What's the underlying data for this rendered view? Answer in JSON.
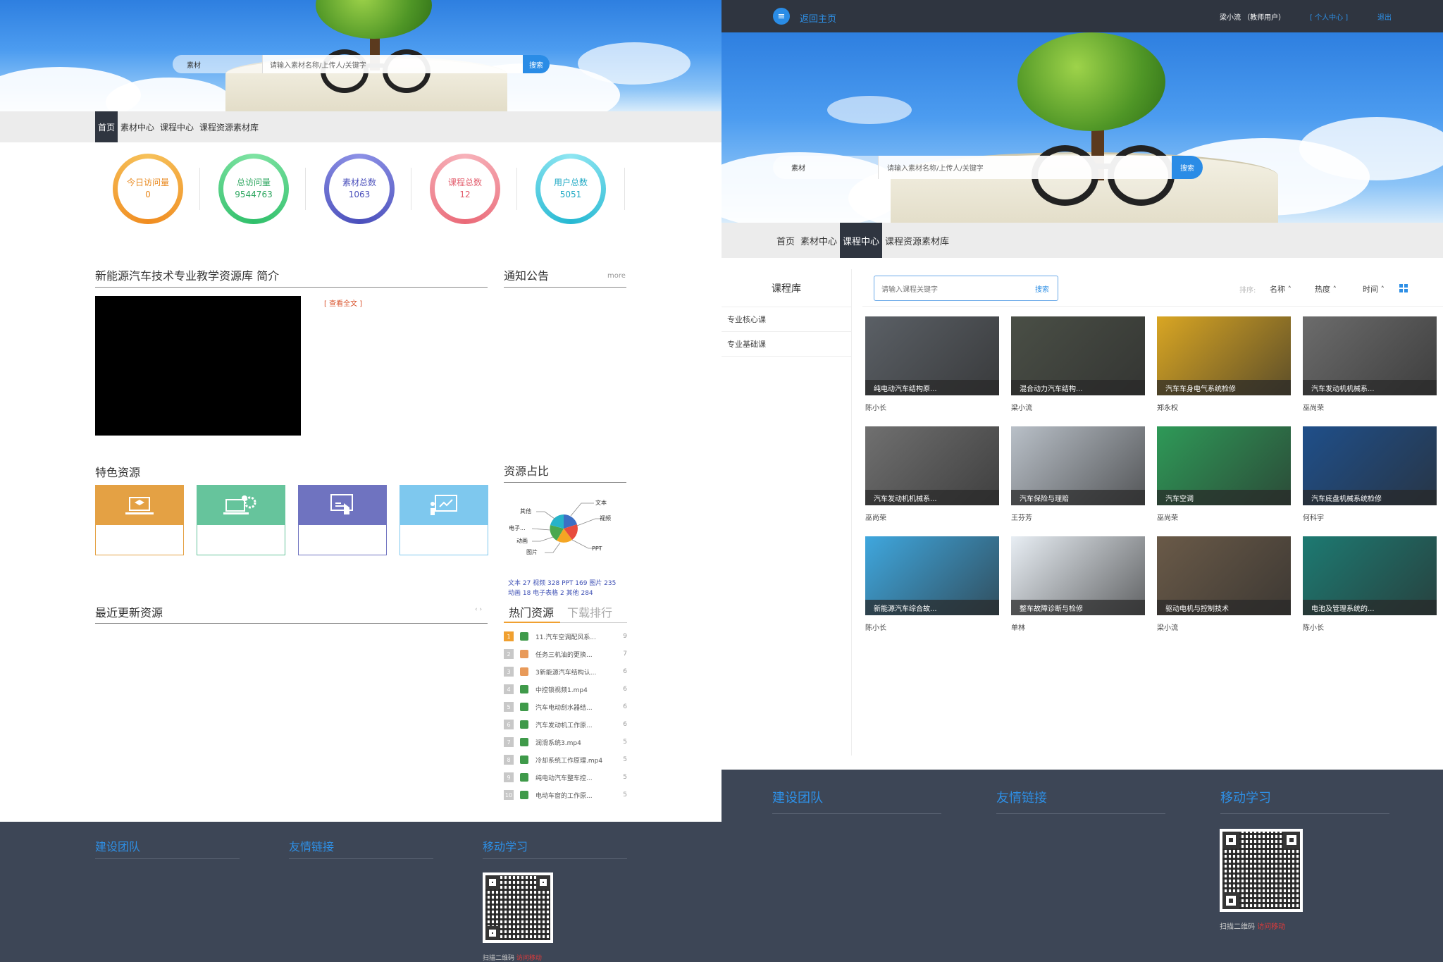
{
  "left": {
    "search": {
      "select": "素材",
      "placeholder": "请输入素材名称/上传人/关键字",
      "button": "搜索"
    },
    "nav": [
      "首页",
      "素材中心",
      "课程中心",
      "课程资源素材库"
    ],
    "nav_active": "首页",
    "stats": [
      {
        "label": "今日访问量",
        "value": "0",
        "color": "#f0a030"
      },
      {
        "label": "总访问量",
        "value": "9544763",
        "color": "#3cc77a"
      },
      {
        "label": "素材总数",
        "value": "1063",
        "color": "#5a5fc8"
      },
      {
        "label": "课程总数",
        "value": "12",
        "color": "#f07a86"
      },
      {
        "label": "用户总数",
        "value": "5051",
        "color": "#33c3d8"
      }
    ],
    "intro_title": "新能源汽车技术专业教学资源库 简介",
    "read_more": "[ 查看全文 ]",
    "notice_title": "通知公告",
    "notice_more": "more",
    "featured_title": "特色资源",
    "featured_colors": [
      "#e4a144",
      "#66c49c",
      "#6f73c0",
      "#7ec8ee"
    ],
    "ratio_title": "资源占比",
    "pie_labels": [
      "文本",
      "视频",
      "PPT",
      "其他",
      "电子...",
      "动画",
      "图片"
    ],
    "ratio_line1": "文本 27 视频 328 PPT 169 图片 235",
    "ratio_line2": "动画 18 电子表格 2 其他 284",
    "recent_title": "最近更新资源",
    "tabs": [
      "热门资源",
      "下载排行"
    ],
    "hot": [
      {
        "rank": "1",
        "name": "11.汽车空调配风系...",
        "count": "9"
      },
      {
        "rank": "2",
        "name": "任务三机油的更换...",
        "count": "7"
      },
      {
        "rank": "3",
        "name": "3新能源汽车结构认...",
        "count": "6"
      },
      {
        "rank": "4",
        "name": "中控锁视频1.mp4",
        "count": "6"
      },
      {
        "rank": "5",
        "name": "汽车电动刮水器结...",
        "count": "6"
      },
      {
        "rank": "6",
        "name": "汽车发动机工作原...",
        "count": "6"
      },
      {
        "rank": "7",
        "name": "润滑系统3.mp4",
        "count": "5"
      },
      {
        "rank": "8",
        "name": "冷却系统工作原理.mp4",
        "count": "5"
      },
      {
        "rank": "9",
        "name": "纯电动汽车整车控...",
        "count": "5"
      },
      {
        "rank": "10",
        "name": "电动车窗的工作原...",
        "count": "5"
      }
    ],
    "footer": {
      "team": "建设团队",
      "links": "友情链接",
      "mobile": "移动学习",
      "scan": "扫描二维码",
      "scan_link": "访问移动"
    }
  },
  "right": {
    "back_home": "返回主页",
    "user": "梁小流 （教师用户）",
    "personal": "[ 个人中心 ]",
    "logout": "退出",
    "search": {
      "select": "素材",
      "placeholder": "请输入素材名称/上传人/关键字",
      "button": "搜索"
    },
    "nav": [
      "首页",
      "素材中心",
      "课程中心",
      "课程资源素材库"
    ],
    "nav_active": "课程中心",
    "library_title": "课程库",
    "categories": [
      "专业核心课",
      "专业基础课"
    ],
    "course_search_placeholder": "请输入课程关键字",
    "course_search_btn": "搜索",
    "sort_label": "排序:",
    "sort": [
      "名称",
      "热度",
      "时间"
    ],
    "courses": [
      {
        "title": "纯电动汽车结构原...",
        "author": "陈小长",
        "bg": "#5b6066"
      },
      {
        "title": "混合动力汽车结构...",
        "author": "梁小流",
        "bg": "#4a4f46"
      },
      {
        "title": "汽车车身电气系统检修",
        "author": "郑永权",
        "bg": "#d9a623"
      },
      {
        "title": "汽车发动机机械系...",
        "author": "巫尚荣",
        "bg": "#6c6c6c"
      },
      {
        "title": "汽车发动机机械系...",
        "author": "巫尚荣",
        "bg": "#707070"
      },
      {
        "title": "汽车保险与理赔",
        "author": "王芬芳",
        "bg": "#b9c0c8"
      },
      {
        "title": "汽车空调",
        "author": "巫尚荣",
        "bg": "#2e9a58"
      },
      {
        "title": "汽车底盘机械系统检修",
        "author": "何科宇",
        "bg": "#1f4f8a"
      },
      {
        "title": "新能源汽车综合故...",
        "author": "陈小长",
        "bg": "#3fa7de"
      },
      {
        "title": "整车故障诊断与检修",
        "author": "单林",
        "bg": "#e8eef4"
      },
      {
        "title": "驱动电机与控制技术",
        "author": "梁小流",
        "bg": "#6a5a48"
      },
      {
        "title": "电池及管理系统的...",
        "author": "陈小长",
        "bg": "#1d7a72"
      }
    ],
    "footer": {
      "team": "建设团队",
      "links": "友情链接",
      "mobile": "移动学习",
      "scan": "扫描二维码",
      "scan_link": "访问移动"
    }
  }
}
